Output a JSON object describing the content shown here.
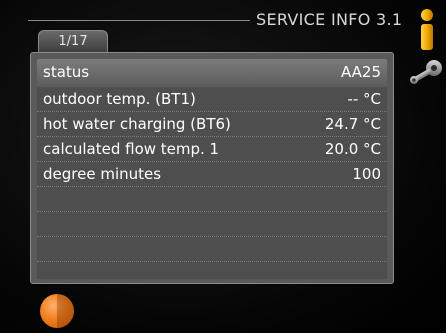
{
  "header": {
    "menu_title": "SERVICE INFO 3.1",
    "page_indicator": "1/17"
  },
  "status": {
    "label": "status",
    "value": "AA25"
  },
  "rows": [
    {
      "label": "outdoor temp. (BT1)",
      "value": "-- °C"
    },
    {
      "label": "hot water charging (BT6)",
      "value": "24.7 °C"
    },
    {
      "label": "calculated flow temp. 1",
      "value": "20.0 °C"
    },
    {
      "label": "degree minutes",
      "value": "100"
    },
    {
      "label": "",
      "value": ""
    },
    {
      "label": "",
      "value": ""
    },
    {
      "label": "",
      "value": ""
    },
    {
      "label": "",
      "value": ""
    }
  ],
  "icons": {
    "info": "info-icon",
    "tools": "wrench-tools-icon",
    "control": "orange-control-knob-icon"
  },
  "colors": {
    "accent": "#f0801e",
    "info_icon": "#f2a900"
  }
}
